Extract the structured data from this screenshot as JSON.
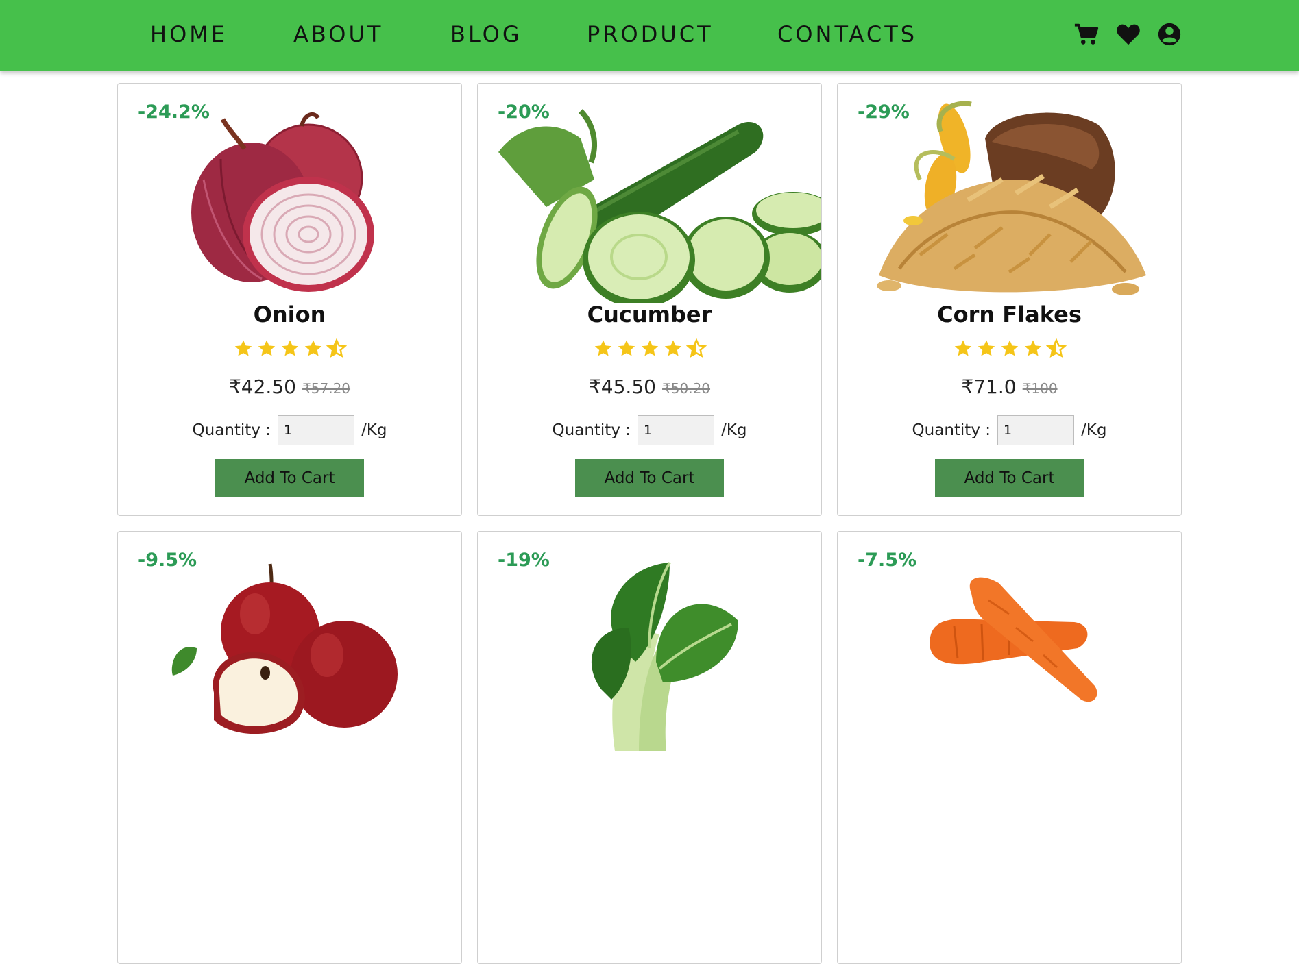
{
  "nav": {
    "links": [
      "HOME",
      "ABOUT",
      "BLOG",
      "PRODUCT",
      "CONTACTS"
    ],
    "icons": [
      "cart-icon",
      "heart-icon",
      "user-icon"
    ],
    "color": "#46c04b"
  },
  "labels": {
    "quantity": "Quantity :",
    "unit": "/Kg",
    "add_to_cart": "Add To Cart"
  },
  "products": [
    {
      "name": "Onion",
      "discount": "-24.2%",
      "price": "₹42.50",
      "old_price": "₹57.20",
      "rating": 4.5,
      "quantity": "1"
    },
    {
      "name": "Cucumber",
      "discount": "-20%",
      "price": "₹45.50",
      "old_price": "₹50.20",
      "rating": 4.5,
      "quantity": "1"
    },
    {
      "name": "Corn Flakes",
      "discount": "-29%",
      "price": "₹71.0",
      "old_price": "₹100",
      "rating": 4.5,
      "quantity": "1"
    },
    {
      "discount": "-9.5%"
    },
    {
      "discount": "-19%"
    },
    {
      "discount": "-7.5%"
    }
  ],
  "colors": {
    "discount": "#2c9b56",
    "star": "#f5c518",
    "button": "#4b8f4f"
  }
}
